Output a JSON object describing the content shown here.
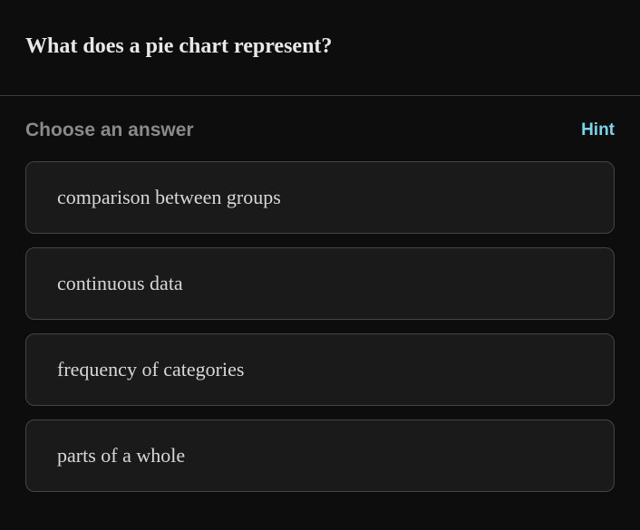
{
  "question": {
    "text": "What does a pie chart represent?"
  },
  "prompt": {
    "choose_label": "Choose an answer",
    "hint_label": "Hint"
  },
  "answers": [
    {
      "text": "comparison between groups"
    },
    {
      "text": "continuous data"
    },
    {
      "text": "frequency of categories"
    },
    {
      "text": "parts of a whole"
    }
  ]
}
